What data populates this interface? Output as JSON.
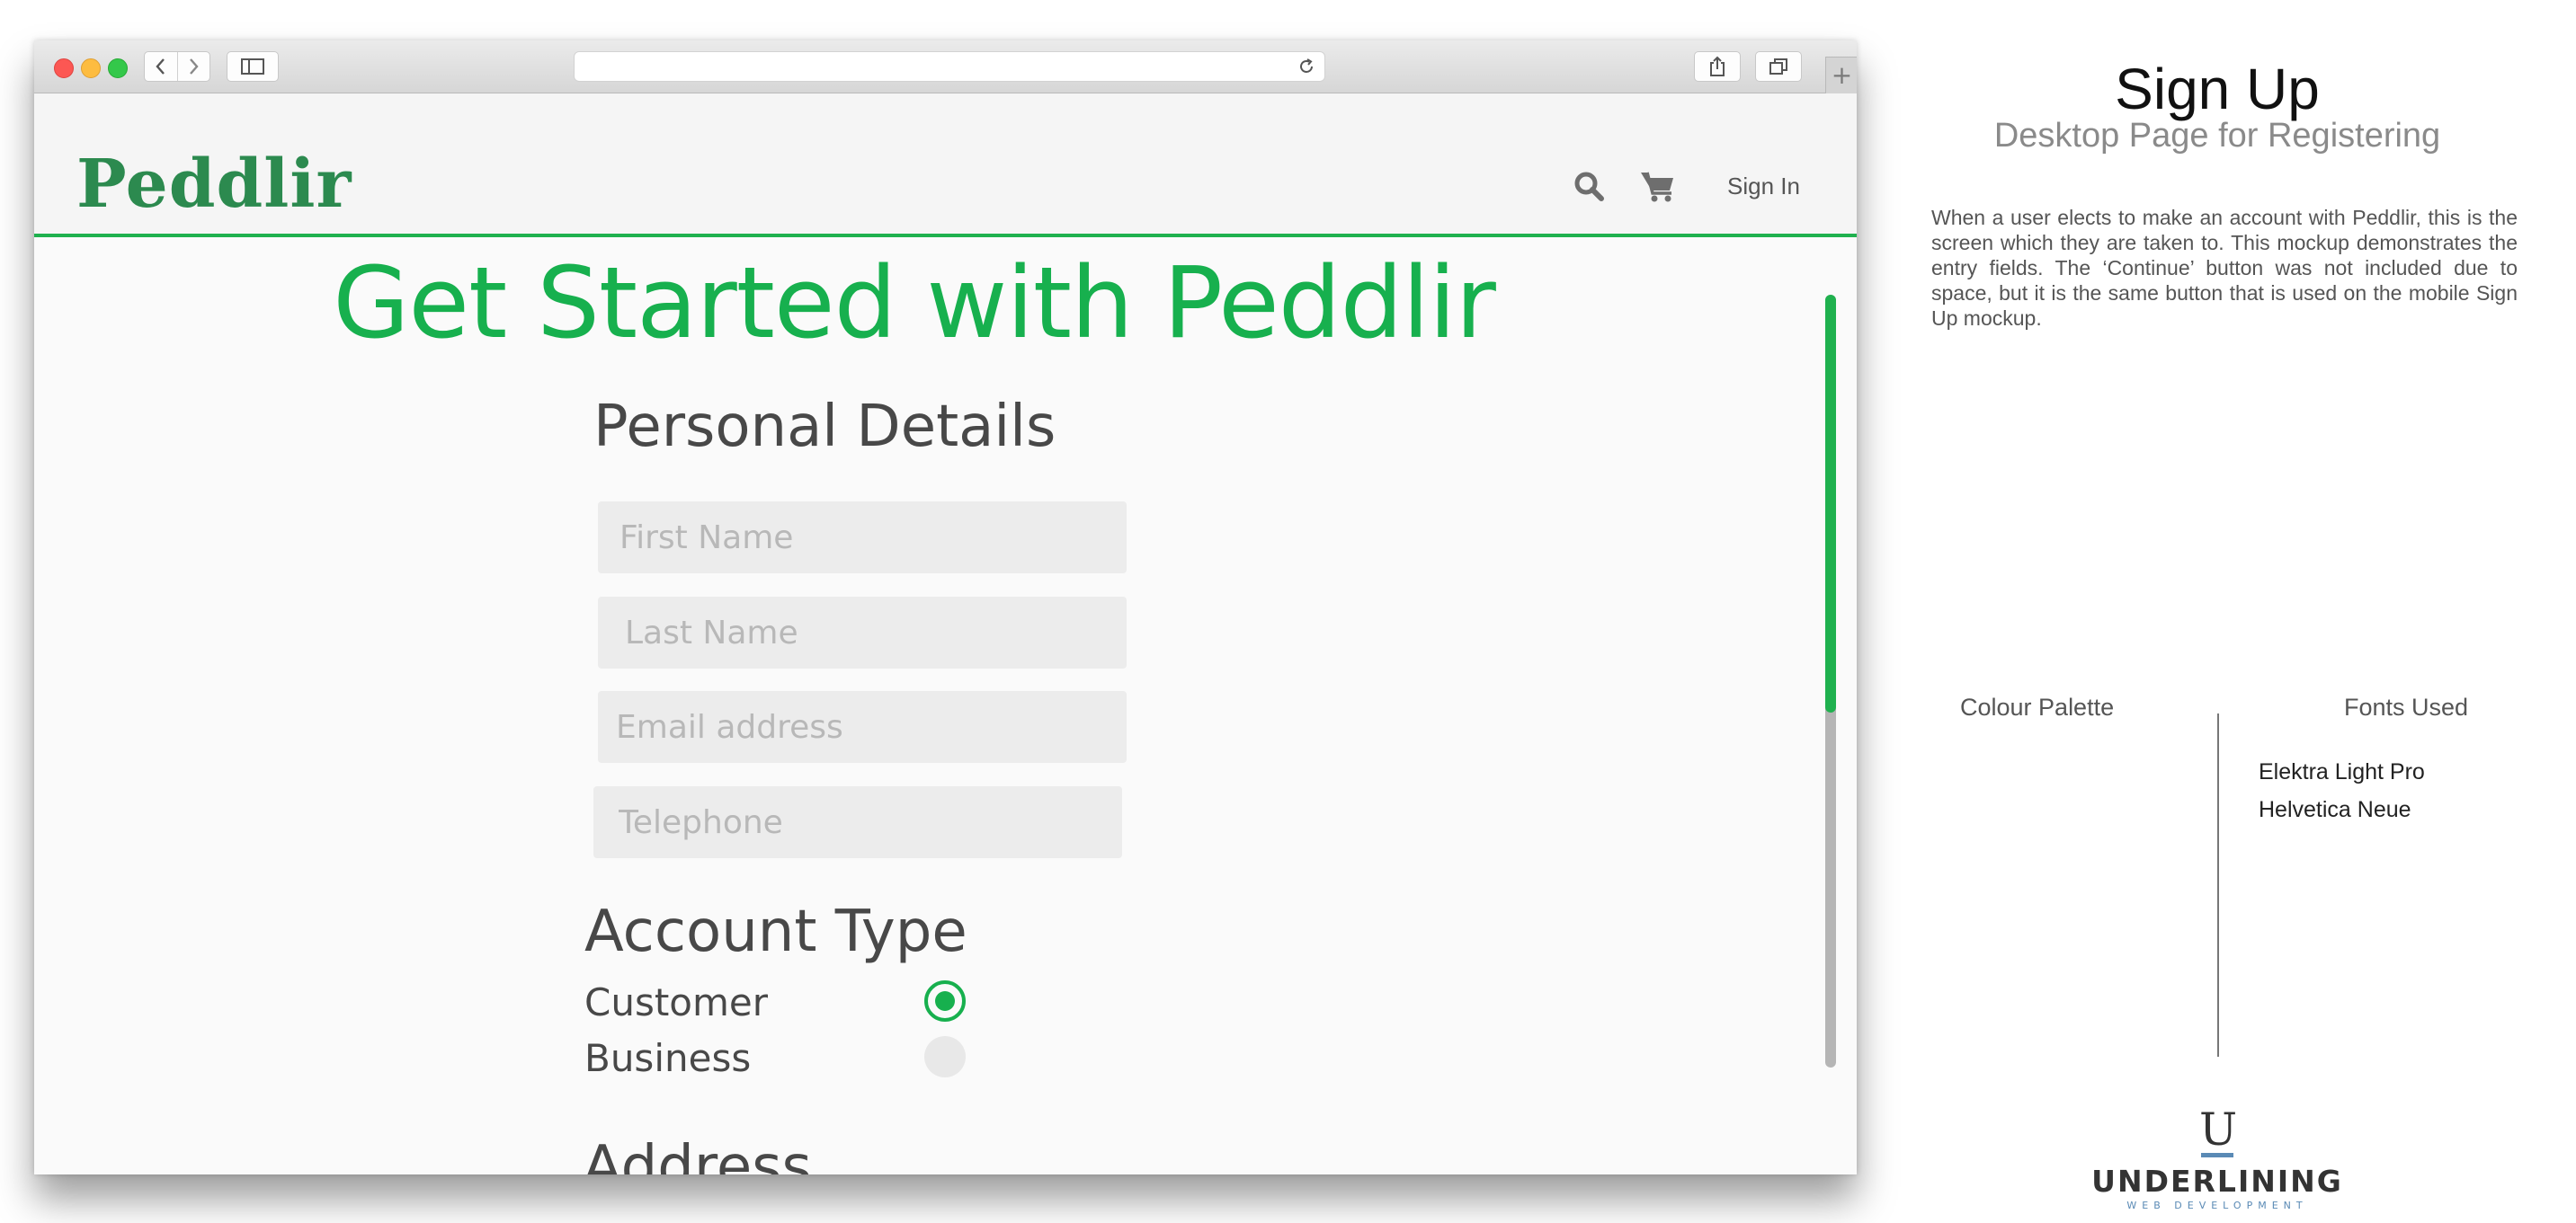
{
  "browser": {
    "address_value": ""
  },
  "site": {
    "logo": "Peddlir",
    "signin_label": "Sign In"
  },
  "page": {
    "hero_title": "Get Started with Peddlir",
    "personal_heading": "Personal Details",
    "fields": {
      "first_name_placeholder": "First Name",
      "last_name_placeholder": "Last Name",
      "email_placeholder": "Email address",
      "telephone_placeholder": "Telephone"
    },
    "account_heading": "Account Type",
    "account_options": [
      {
        "label": "Customer",
        "selected": true
      },
      {
        "label": "Business",
        "selected": false
      }
    ],
    "address_heading": "Address",
    "scroll_position_fraction": 0.33
  },
  "panel": {
    "title": "Sign Up",
    "subtitle": "Desktop Page for Registering",
    "description": "When a user elects to make an account with Peddlir, this is the screen which they are taken to.  This mockup demonstrates the entry fields.  The ‘Continue’ button was not included due to space, but it is the same button that is used on the mobile Sign Up mockup.",
    "palette_heading": "Colour Palette",
    "fonts_heading": "Fonts Used",
    "fonts": [
      "Elektra Light Pro",
      "Helvetica Neue"
    ]
  },
  "brand": {
    "letter": "U",
    "name": "UNDERLINING",
    "tagline": "WEB DEVELOPMENT"
  },
  "colors": {
    "accent_green": "#17b04e",
    "logo_green": "#2c8a4f",
    "brand_blue": "#5a8ab5"
  },
  "icons": [
    "back-icon",
    "forward-icon",
    "sidebar-icon",
    "reload-icon",
    "share-icon",
    "tabs-icon",
    "search-icon",
    "cart-icon"
  ]
}
